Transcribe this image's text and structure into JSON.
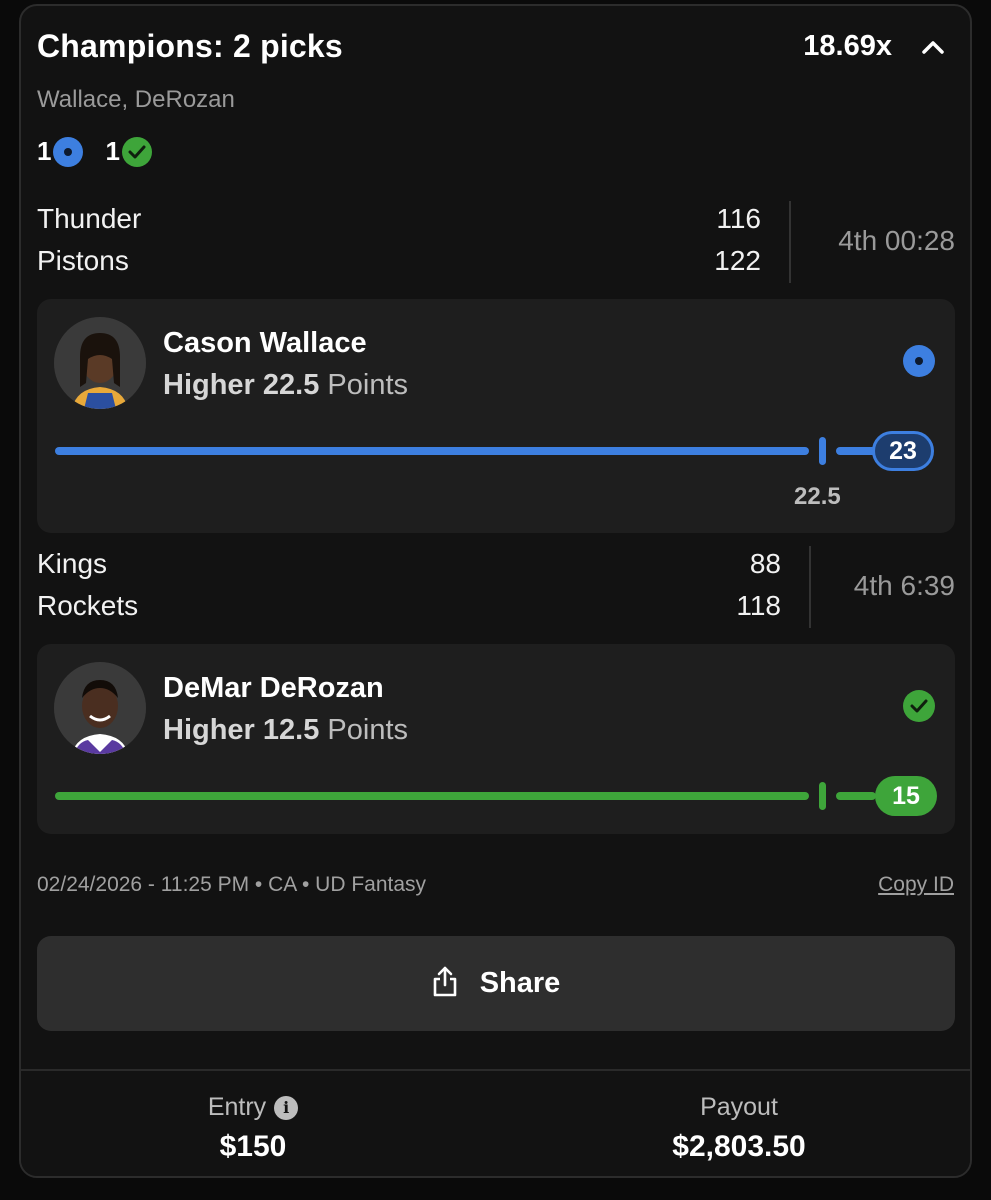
{
  "header": {
    "title": "Champions: 2 picks",
    "multiplier": "18.69x",
    "subtitle": "Wallace, DeRozan",
    "status_summary": {
      "live_count": "1",
      "won_count": "1"
    }
  },
  "games": [
    {
      "team1": "Thunder",
      "score1": "116",
      "team2": "Pistons",
      "score2": "122",
      "clock": "4th 00:28"
    },
    {
      "team1": "Kings",
      "score1": "88",
      "team2": "Rockets",
      "score2": "118",
      "clock": "4th 6:39"
    }
  ],
  "picks": [
    {
      "player": "Cason Wallace",
      "direction": "Higher",
      "line": "22.5",
      "stat": "Points",
      "current": "23",
      "line_label": "22.5",
      "status": "live",
      "status_icon": "live-dot-icon",
      "color": "#3d7fe0",
      "progress": 1.0
    },
    {
      "player": "DeMar DeRozan",
      "direction": "Higher",
      "line": "12.5",
      "stat": "Points",
      "current": "15",
      "status": "won",
      "status_icon": "check-icon",
      "color": "#3ea53a",
      "progress": 1.0
    }
  ],
  "meta": {
    "info": "02/24/2026 - 11:25 PM • CA • UD Fantasy",
    "copy_id": "Copy ID"
  },
  "share": {
    "label": "Share"
  },
  "footer": {
    "entry_label": "Entry",
    "entry_value": "$150",
    "payout_label": "Payout",
    "payout_value": "$2,803.50"
  }
}
